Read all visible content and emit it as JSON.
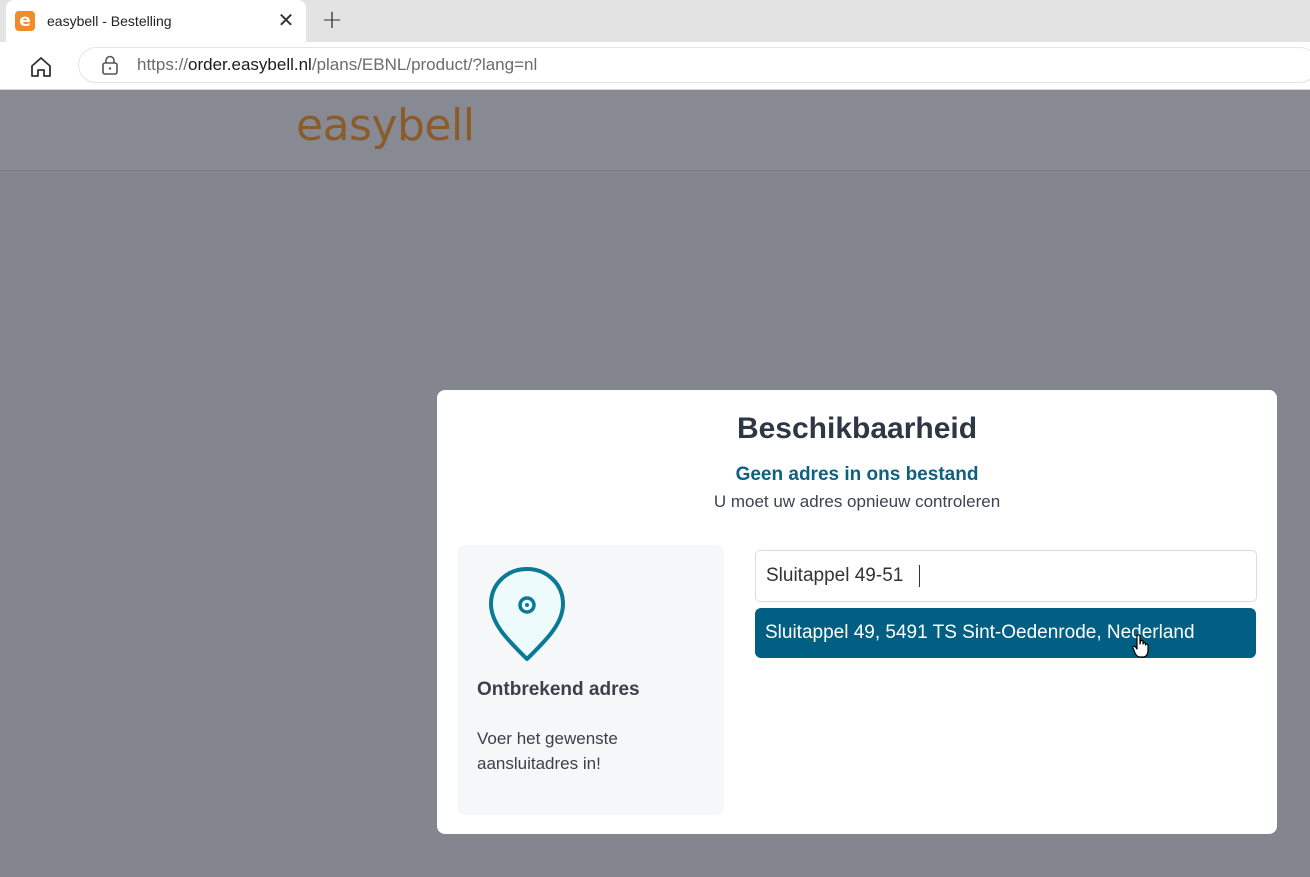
{
  "browser": {
    "tab_title": "easybell - Bestelling",
    "favicon_letter": "e",
    "tab_close": "✕",
    "new_tab": "+",
    "url_prefix": "https://",
    "url_host": "order.easybell.nl",
    "url_path": "/plans/EBNL/product/?lang=nl",
    "icons": [
      "home-icon",
      "lock-icon",
      "close-icon",
      "plus-icon"
    ]
  },
  "header": {
    "logo_text": "easybell",
    "logo_color": "#8a5c2b"
  },
  "modal": {
    "title": "Beschikbaarheid",
    "subtitle": "Geen adres in ons bestand",
    "description": "U moet uw adres opnieuw controleren",
    "info_card": {
      "icon": "map-pin-icon",
      "title": "Ontbrekend adres",
      "text": "Voer het gewenste aansluitadres in!"
    },
    "address_input": {
      "value": "Sluitappel 49-51"
    },
    "suggestion": "Sluitappel 49, 5491 TS Sint-Oedenrode, Nederland",
    "accent_color": "#005f82"
  }
}
